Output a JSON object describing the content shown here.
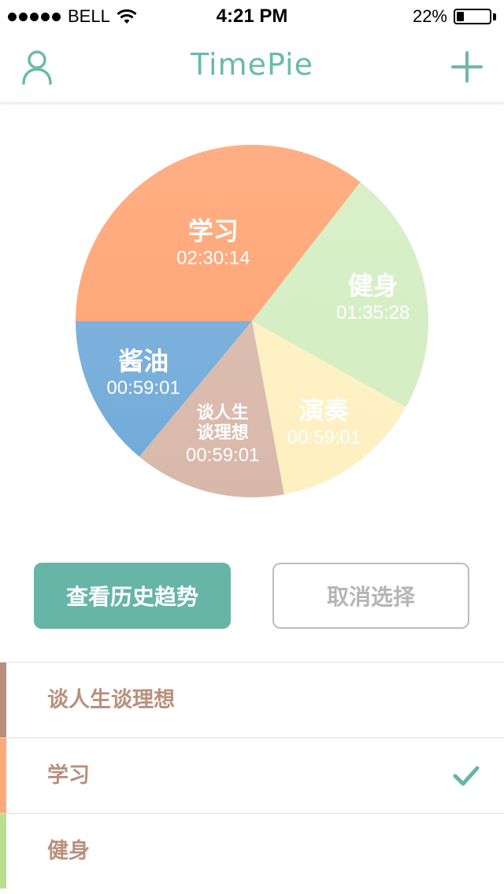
{
  "status_bar": {
    "carrier": "BELL",
    "time": "4:21 PM",
    "battery_percent": "22%",
    "battery_level": 0.22,
    "signal_dots": 5
  },
  "nav": {
    "title": "TimePie",
    "left_icon": "user-icon",
    "right_icon": "plus-icon",
    "accent_color": "#6bbaa8"
  },
  "chart_data": {
    "type": "pie",
    "slices": [
      {
        "name": "学习",
        "time": "02:30:14",
        "seconds": 9014,
        "color": "#ffa87a",
        "label_color": "#ffffff"
      },
      {
        "name": "健身",
        "time": "01:35:28",
        "seconds": 5728,
        "color": "#d5eec3",
        "label_color": "#ffffff"
      },
      {
        "name": "演奏",
        "time": "00:59:01",
        "seconds": 3541,
        "color": "#fef0c0",
        "label_color": "#ffffff"
      },
      {
        "name": "谈人生谈理想",
        "time": "00:59:01",
        "seconds": 3541,
        "color": "#d8b8aa",
        "label_color": "#ffffff"
      },
      {
        "name": "酱油",
        "time": "00:59:01",
        "seconds": 3541,
        "color": "#72abd9",
        "label_color": "#ffffff"
      }
    ]
  },
  "buttons": {
    "history": "查看历史趋势",
    "cancel": "取消选择"
  },
  "list": {
    "items": [
      {
        "label": "谈人生谈理想",
        "color": "#b78d7c",
        "selected": false
      },
      {
        "label": "学习",
        "color": "#ffa87a",
        "selected": true
      },
      {
        "label": "健身",
        "color": "#b8e08f",
        "selected": false
      }
    ],
    "check_color": "#66b5a6",
    "label_color": "#b9907c"
  }
}
